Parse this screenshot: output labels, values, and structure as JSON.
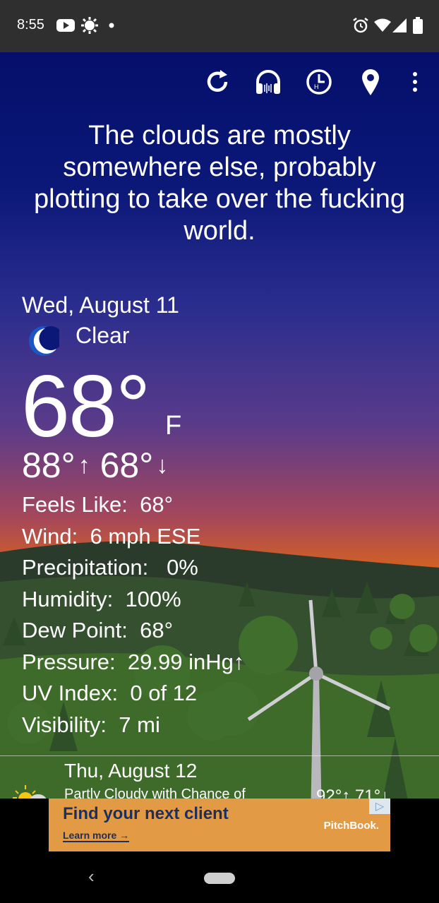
{
  "status_bar": {
    "time": "8:55",
    "icons": [
      "youtube-icon",
      "brightness-icon",
      "dot-icon",
      "alarm-icon",
      "wifi-icon",
      "signal-icon",
      "battery-icon"
    ]
  },
  "toolbar": {
    "buttons": [
      "refresh-icon",
      "audio-headphones-icon",
      "hourly-clock-icon",
      "location-pin-icon",
      "more-vert-icon"
    ]
  },
  "quip": "The clouds are mostly somewhere else, probably plotting to take over the fucking world.",
  "current": {
    "date": "Wed, August 11",
    "condition": "Clear",
    "condition_icon": "moon-icon",
    "temperature": "68°",
    "unit": "F",
    "high": "88°",
    "low": "68°"
  },
  "details": [
    {
      "label": "Feels Like:",
      "value": "68°"
    },
    {
      "label": "Wind:",
      "value": "6 mph ESE"
    },
    {
      "label": "Precipitation:",
      "value": "0%"
    },
    {
      "label": "Humidity:",
      "value": "100%"
    },
    {
      "label": "Dew Point:",
      "value": "68°"
    },
    {
      "label": "Pressure:",
      "value": "29.99 inHg↑"
    },
    {
      "label": "UV Index:",
      "value": "0 of 12"
    },
    {
      "label": "Visibility:",
      "value": "7 mi"
    }
  ],
  "forecast": {
    "date": "Thu, August 12",
    "description": "Partly Cloudy with Chance of",
    "temps": "92°↑ 71°↓",
    "icon": "partly-cloudy-icon"
  },
  "ad": {
    "headline": "Find your next client",
    "cta": "Learn more →",
    "brand": "PitchBook."
  },
  "colors": {
    "sky_top": "#050f6b",
    "sky_sunset": "#e26f14",
    "ad_background": "#e39a45",
    "ad_text": "#1d2f5c"
  }
}
